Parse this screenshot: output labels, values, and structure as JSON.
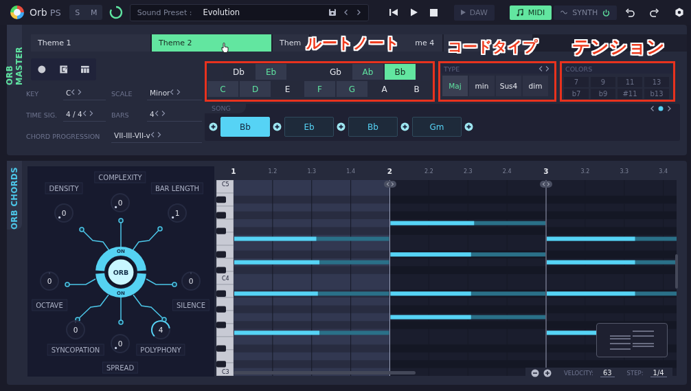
{
  "header": {
    "app_name": "Orb",
    "app_suffix": "PS",
    "modes": [
      {
        "label": "S"
      },
      {
        "label": "M"
      }
    ],
    "preset": {
      "label": "Sound Preset :",
      "value": "Evolution"
    },
    "daw": {
      "label": "DAW"
    },
    "outputs": [
      {
        "label": "MIDI",
        "selected": true,
        "kind": "midi"
      },
      {
        "label": "SYNTH",
        "selected": false,
        "kind": "synth"
      }
    ]
  },
  "master": {
    "tab_label": "ORB MASTER",
    "themes": [
      {
        "label": "Theme 1",
        "selected": false
      },
      {
        "label": "Theme 2",
        "selected": true
      },
      {
        "label": "Them",
        "selected": false
      },
      {
        "label": "me 4",
        "selected": false
      }
    ],
    "params": [
      {
        "label": "KEY",
        "value": "C"
      },
      {
        "label": "SCALE",
        "value": "Minor"
      },
      {
        "label": "TIME SIG.",
        "value": "4 / 4"
      },
      {
        "label": "BARS",
        "value": "4"
      },
      {
        "label": "CHORD PROGRESSION",
        "value": "VII-III-VII-v"
      }
    ],
    "root_notes": {
      "annotated": true,
      "sharps": [
        {
          "label": "Db",
          "in_scale": false,
          "selected": false
        },
        {
          "label": "Eb",
          "in_scale": true,
          "selected": false
        },
        {
          "label": "Gb",
          "in_scale": false,
          "selected": false
        },
        {
          "label": "Ab",
          "in_scale": true,
          "selected": false
        },
        {
          "label": "Bb",
          "in_scale": true,
          "selected": true
        }
      ],
      "naturals": [
        {
          "label": "C",
          "in_scale": true,
          "selected": false
        },
        {
          "label": "D",
          "in_scale": true,
          "selected": false
        },
        {
          "label": "E",
          "in_scale": false,
          "selected": false
        },
        {
          "label": "F",
          "in_scale": true,
          "selected": false
        },
        {
          "label": "G",
          "in_scale": true,
          "selected": false
        },
        {
          "label": "A",
          "in_scale": false,
          "selected": false
        },
        {
          "label": "B",
          "in_scale": false,
          "selected": false
        }
      ]
    },
    "chord_type": {
      "annotated": true,
      "title": "TYPE",
      "options": [
        {
          "label": "Maj",
          "selected": true
        },
        {
          "label": "min",
          "selected": false
        },
        {
          "label": "Sus4",
          "selected": false
        },
        {
          "label": "dim",
          "selected": false
        }
      ]
    },
    "colors": {
      "annotated": true,
      "title": "COLORS",
      "options": [
        {
          "label": "7",
          "selected": false
        },
        {
          "label": "9",
          "selected": false
        },
        {
          "label": "11",
          "selected": false
        },
        {
          "label": "13",
          "selected": false
        },
        {
          "label": "b7",
          "selected": false
        },
        {
          "label": "b9",
          "selected": false
        },
        {
          "label": "#11",
          "selected": false
        },
        {
          "label": "b13",
          "selected": false
        }
      ]
    },
    "song": {
      "title": "SONG",
      "chords": [
        {
          "label": "Bb",
          "selected": true
        },
        {
          "label": "Eb",
          "selected": false
        },
        {
          "label": "Bb",
          "selected": false
        },
        {
          "label": "Gm",
          "selected": false
        }
      ]
    }
  },
  "annotations": [
    {
      "label": "ルートノート"
    },
    {
      "label": "コードタイプ"
    },
    {
      "label": "テンション"
    }
  ],
  "chords": {
    "tab_label": "ORB CHORDS",
    "knobs": [
      {
        "label": "DENSITY",
        "value": "0",
        "kind": "unipolar",
        "active": false
      },
      {
        "label": "COMPLEXITY",
        "value": "0",
        "kind": "unipolar",
        "active": false
      },
      {
        "label": "BAR LENGTH",
        "value": "1",
        "kind": "unipolar",
        "active": false
      },
      {
        "label": "OCTAVE",
        "value": "0",
        "kind": "bipolar",
        "active": false
      },
      {
        "label": "SILENCE",
        "value": "0",
        "kind": "bipolar",
        "active": false
      },
      {
        "label": "SYNCOPATION",
        "value": "0",
        "kind": "bipolar",
        "active": false
      },
      {
        "label": "SPREAD",
        "value": "0",
        "kind": "unipolar",
        "active": false
      },
      {
        "label": "POLYPHONY",
        "value": "4",
        "kind": "unipolar",
        "active": true
      }
    ],
    "orb": {
      "label": "ORB",
      "toggles": [
        {
          "label": "ON",
          "on": true
        },
        {
          "label": "ON",
          "on": true
        }
      ]
    },
    "roll": {
      "ticks": [
        {
          "label": "1",
          "major": true
        },
        {
          "label": "1.2",
          "major": false
        },
        {
          "label": "1.3",
          "major": false
        },
        {
          "label": "1.4",
          "major": false
        },
        {
          "label": "2",
          "major": true
        },
        {
          "label": "2.2",
          "major": false
        },
        {
          "label": "2.3",
          "major": false
        },
        {
          "label": "2.4",
          "major": false
        },
        {
          "label": "3",
          "major": true
        },
        {
          "label": "3.2",
          "major": false
        },
        {
          "label": "3.3",
          "major": false
        },
        {
          "label": "3.4",
          "major": false
        }
      ],
      "key_labels": [
        {
          "label": "C5"
        },
        {
          "label": "C4"
        },
        {
          "label": "C3"
        }
      ],
      "bars": [
        {
          "selected": true
        },
        {
          "selected": false
        },
        {
          "selected": false
        }
      ],
      "velocity": {
        "label": "VELOCITY:",
        "value": "63"
      },
      "step": {
        "label": "STEP:",
        "value": "1/4"
      }
    }
  }
}
